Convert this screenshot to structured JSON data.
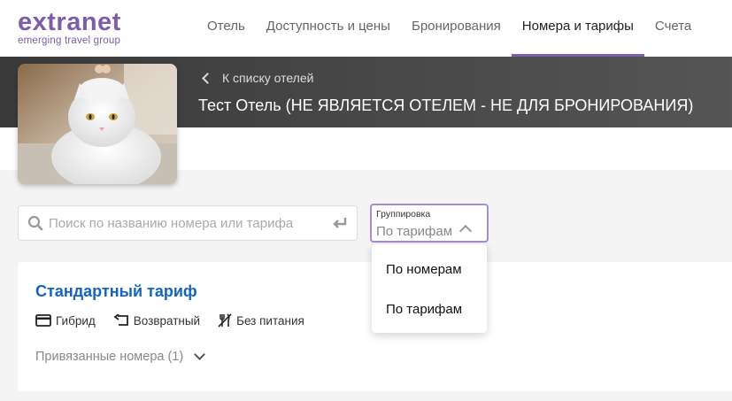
{
  "logo": {
    "main": "extranet",
    "sub": "emerging travel group"
  },
  "nav": {
    "items": [
      {
        "label": "Отель"
      },
      {
        "label": "Доступность и цены"
      },
      {
        "label": "Бронирования"
      },
      {
        "label": "Номера и тарифы"
      },
      {
        "label": "Счета"
      }
    ],
    "active_index": 3
  },
  "header": {
    "back_label": "К списку отелей",
    "hotel_title": "Тест Отель (НЕ ЯВЛЯЕТСЯ ОТЕЛЕМ - НЕ ДЛЯ БРОНИРОВАНИЯ)"
  },
  "search": {
    "placeholder": "Поиск по названию номера или тарифа",
    "value": ""
  },
  "grouping": {
    "label": "Группировка",
    "value": "По тарифам",
    "options": [
      "По номерам",
      "По тарифам"
    ]
  },
  "tariff": {
    "title": "Стандартный тариф",
    "tags": [
      {
        "icon": "card-icon",
        "label": "Гибрид"
      },
      {
        "icon": "return-arrow-icon",
        "label": "Возвратный"
      },
      {
        "icon": "no-meal-icon",
        "label": "Без питания"
      }
    ],
    "linked_rooms": "Привязанные номера (1)"
  },
  "colors": {
    "accent": "#7b5ea7",
    "link": "#1565c0",
    "header_bg": "#3a3a3a"
  }
}
